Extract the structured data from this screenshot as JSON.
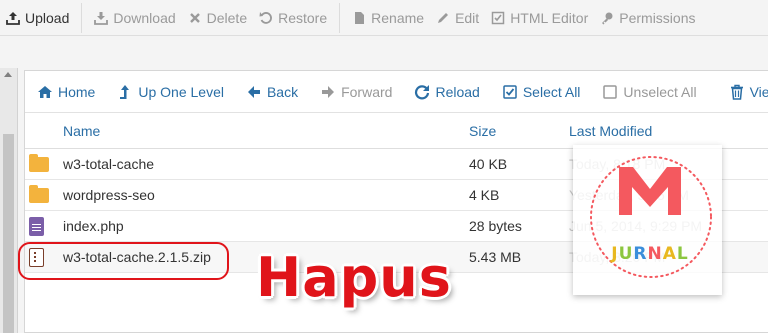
{
  "toolbar": {
    "items": [
      {
        "label": "Upload",
        "icon": "upload-icon",
        "state": "active"
      },
      {
        "label": "Download",
        "icon": "download-icon",
        "state": "disabled"
      },
      {
        "label": "Delete",
        "icon": "delete-icon",
        "state": "disabled"
      },
      {
        "label": "Restore",
        "icon": "restore-icon",
        "state": "disabled"
      },
      {
        "label": "Rename",
        "icon": "rename-icon",
        "state": "disabled"
      },
      {
        "label": "Edit",
        "icon": "edit-icon",
        "state": "disabled"
      },
      {
        "label": "HTML Editor",
        "icon": "html-editor-icon",
        "state": "disabled"
      },
      {
        "label": "Permissions",
        "icon": "key-icon",
        "state": "disabled"
      }
    ]
  },
  "navbar": {
    "items": [
      {
        "label": "Home",
        "icon": "home-icon",
        "state": "active"
      },
      {
        "label": "Up One Level",
        "icon": "level-up-icon",
        "state": "active"
      },
      {
        "label": "Back",
        "icon": "back-arrow-icon",
        "state": "active"
      },
      {
        "label": "Forward",
        "icon": "forward-arrow-icon",
        "state": "disabled"
      },
      {
        "label": "Reload",
        "icon": "reload-icon",
        "state": "active"
      },
      {
        "label": "Select All",
        "icon": "checked-box-icon",
        "state": "active"
      },
      {
        "label": "Unselect All",
        "icon": "empty-box-icon",
        "state": "disabled"
      },
      {
        "label": "View",
        "icon": "trash-icon",
        "state": "active"
      }
    ]
  },
  "table": {
    "columns": [
      "Name",
      "Size",
      "Last Modified"
    ],
    "rows": [
      {
        "name": "w3-total-cache",
        "size": "40 KB",
        "modified": "Today, 8:18 PM",
        "type": "folder"
      },
      {
        "name": "wordpress-seo",
        "size": "4 KB",
        "modified": "Yesterday, 5:25 AM",
        "type": "folder"
      },
      {
        "name": "index.php",
        "size": "28 bytes",
        "modified": "Jun 5, 2014, 9:29 PM",
        "type": "php"
      },
      {
        "name": "w3-total-cache.2.1.5.zip",
        "size": "5.43 MB",
        "modified": "Today, 8:20 PM",
        "type": "zip"
      }
    ]
  },
  "annotation": {
    "label": "Hapus",
    "color": "#e0141a"
  },
  "watermark": {
    "letter": "M",
    "text": "JURNAL",
    "brand_red": "#f4595f",
    "brand_yellow": "#e8b820",
    "brand_green": "#8cc63f",
    "brand_blue": "#3b8edb"
  },
  "colors": {
    "link": "#2a6ea5",
    "disabled": "#9a9a9a",
    "folder": "#f3b33d"
  }
}
